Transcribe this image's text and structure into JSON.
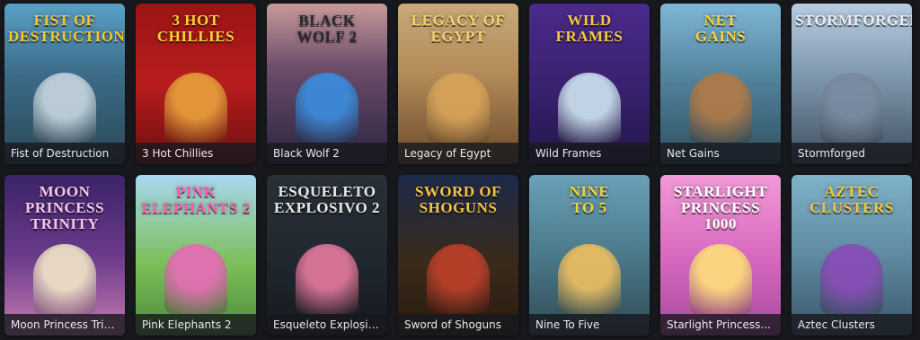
{
  "games": [
    {
      "title": "Fist of Destruction",
      "logo": "Fist of\nDestruction",
      "bg": "linear-gradient(180deg,#5aa0c8 0%,#3b6b86 45%,#2a4758 100%)",
      "logo_color": "#f6c431",
      "accent": "#c8d6e0"
    },
    {
      "title": "3 Hot Chillies",
      "logo": "3 Hot\nChillies",
      "bg": "linear-gradient(180deg,#9b1414 0%,#b81d1d 50%,#6e0e0e 100%)",
      "logo_color": "#f7d23a",
      "accent": "#e8a23c"
    },
    {
      "title": "Black Wolf 2",
      "logo": "Black\nWolf 2",
      "bg": "linear-gradient(180deg,#c89a9a 0%,#6b4d6a 40%,#2a2440 100%)",
      "logo_color": "#2a2a32",
      "accent": "#3a8ee0"
    },
    {
      "title": "Legacy of Egypt",
      "logo": "Legacy of Egypt",
      "bg": "linear-gradient(180deg,#c9a97a 0%,#b28a58 45%,#6b4a2a 100%)",
      "logo_color": "#f0d070",
      "accent": "#d9a45a"
    },
    {
      "title": "Wild Frames",
      "logo": "Wild\nFrames",
      "bg": "linear-gradient(180deg,#4a2a8a 0%,#3a2270 50%,#22164a 100%)",
      "logo_color": "#f4c844",
      "accent": "#cfe6f2"
    },
    {
      "title": "Net Gains",
      "logo": "Net\nGains",
      "bg": "linear-gradient(180deg,#7fb6d6 0%,#4f7f98 50%,#2f4f60 100%)",
      "logo_color": "#f4d23c",
      "accent": "#b27a45"
    },
    {
      "title": "Stormforged",
      "logo": "Stormforged",
      "bg": "linear-gradient(180deg,#b9cde0 0%,#7f98ad 45%,#3f4f60 100%)",
      "logo_color": "#e9eef4",
      "accent": "#7a8aa0"
    },
    {
      "title": "Moon Princess Tri…",
      "logo": "Moon Princess\nTrinity",
      "bg": "linear-gradient(180deg,#3a2468 0%,#6a3a8a 50%,#c47ab0 100%)",
      "logo_color": "#f7c5ea",
      "accent": "#f3e7c8"
    },
    {
      "title": "Pink Elephants 2",
      "logo": "Pink\nElephants 2",
      "bg": "linear-gradient(180deg,#a8d8f0 0%,#7cbf5a 55%,#4e8a3a 100%)",
      "logo_color": "#ff5fb3",
      "accent": "#e86ab8"
    },
    {
      "title": "Esqueleto Exploși…",
      "logo": "Esqueleto\nExplosivo 2",
      "bg": "linear-gradient(180deg,#2a3038 0%,#222830 50%,#15191e 100%)",
      "logo_color": "#e8e8e8",
      "accent": "#e87aa0"
    },
    {
      "title": "Sword of Shoguns",
      "logo": "Sword of\nShoguns",
      "bg": "linear-gradient(180deg,#1d2a4a 0%,#3a2a1a 55%,#2a1a10 100%)",
      "logo_color": "#f4c340",
      "accent": "#c0412a"
    },
    {
      "title": "Nine To Five",
      "logo": "Nine\nTo 5",
      "bg": "linear-gradient(180deg,#6aa0b8 0%,#4a7a8a 50%,#2f4a55 100%)",
      "logo_color": "#f2d23a",
      "accent": "#f0c060"
    },
    {
      "title": "Starlight Princess...",
      "logo": "Starlight\nPrincess\n1000",
      "bg": "linear-gradient(180deg,#f29ad6 0%,#d86ac0 50%,#a84a9c 100%)",
      "logo_color": "#ffffff",
      "accent": "#ffe07a"
    },
    {
      "title": "Aztec Clusters",
      "logo": "Aztec\nClusters",
      "bg": "linear-gradient(180deg,#7fb2c8 0%,#5f8aa2 50%,#3a5568 100%)",
      "logo_color": "#f4c53a",
      "accent": "#8a4ab8"
    }
  ]
}
